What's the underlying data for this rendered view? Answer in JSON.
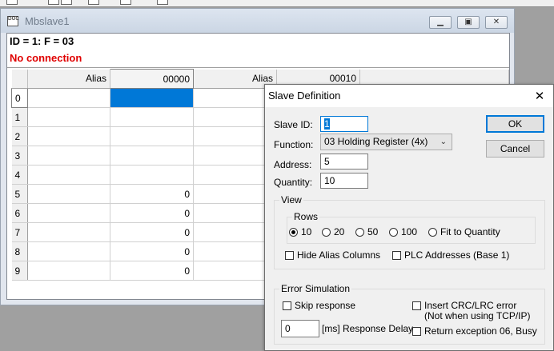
{
  "child_window": {
    "title": "Mbslave1",
    "info_line": "ID = 1: F = 03",
    "status": "No connection",
    "grid": {
      "headers": [
        "Alias",
        "00000",
        "Alias",
        "00010"
      ],
      "rows": [
        {
          "num": "0",
          "val": ""
        },
        {
          "num": "1",
          "val": ""
        },
        {
          "num": "2",
          "val": ""
        },
        {
          "num": "3",
          "val": ""
        },
        {
          "num": "4",
          "val": ""
        },
        {
          "num": "5",
          "val": "0"
        },
        {
          "num": "6",
          "val": "0"
        },
        {
          "num": "7",
          "val": "0"
        },
        {
          "num": "8",
          "val": "0"
        },
        {
          "num": "9",
          "val": "0"
        }
      ]
    }
  },
  "dialog": {
    "title": "Slave Definition",
    "close_glyph": "✕",
    "slave_id": {
      "label": "Slave ID:",
      "value": "1"
    },
    "function": {
      "label": "Function:",
      "value": "03 Holding Register (4x)"
    },
    "address": {
      "label": "Address:",
      "value": "5"
    },
    "quantity": {
      "label": "Quantity:",
      "value": "10"
    },
    "ok_label": "OK",
    "cancel_label": "Cancel",
    "view": {
      "label": "View",
      "rows_label": "Rows",
      "row_options": [
        "10",
        "20",
        "50",
        "100",
        "Fit to Quantity"
      ],
      "selected_rows": "10",
      "hide_alias": "Hide Alias Columns",
      "plc_addresses": "PLC Addresses (Base 1)"
    },
    "error_sim": {
      "label": "Error Simulation",
      "skip_response": "Skip response",
      "insert_crc": "Insert CRC/LRC error",
      "insert_crc_note": "(Not when using TCP/IP)",
      "delay_value": "0",
      "delay_label": "[ms] Response Delay",
      "return_exception": "Return exception 06, Busy"
    }
  }
}
